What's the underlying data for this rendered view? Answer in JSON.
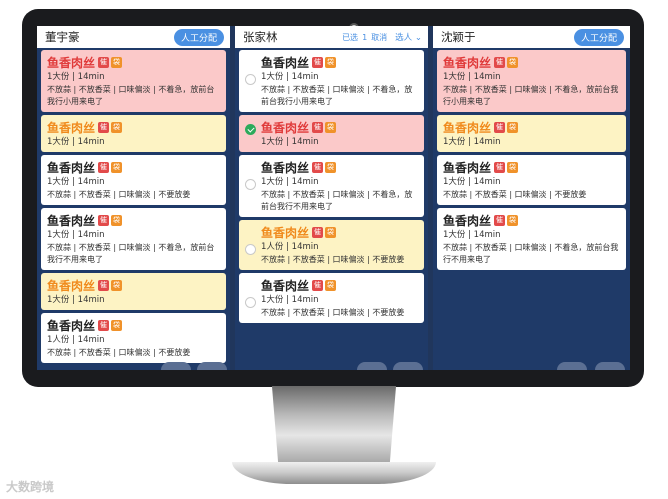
{
  "watermark": "大数跨境",
  "columns": [
    {
      "name": "董宇豪",
      "assign_label": "人工分配",
      "cards": [
        {
          "dish": "鱼香肉丝",
          "urge": "催",
          "bag": "袋",
          "meta": "1大份 | 14min",
          "notes": "不放蒜 | 不放香菜 | 口味偏淡 | 不着急，放前台我行小用来电了"
        },
        {
          "dish": "鱼香肉丝",
          "urge": "催",
          "bag": "袋",
          "meta": "1大份 | 14min",
          "notes": ""
        },
        {
          "dish": "鱼香肉丝",
          "urge": "催",
          "bag": "袋",
          "meta": "1大份 | 14min",
          "notes": "不放蒜 | 不放香菜 | 口味偏淡 | 不要放姜"
        },
        {
          "dish": "鱼香肉丝",
          "urge": "催",
          "bag": "袋",
          "meta": "1大份 | 14min",
          "notes": "不放蒜 | 不放香菜 | 口味偏淡 | 不着急，放前台我行不用来电了"
        },
        {
          "dish": "鱼香肉丝",
          "urge": "催",
          "bag": "袋",
          "meta": "1大份 | 14min",
          "notes": ""
        },
        {
          "dish": "鱼香肉丝",
          "urge": "催",
          "bag": "袋",
          "meta": "1人份 | 14min",
          "notes": "不放蒜 | 不放香菜 | 口味偏淡 | 不要放姜"
        }
      ]
    },
    {
      "name": "张家林",
      "selected_prefix": "已选",
      "selected_count": "1",
      "cancel_label": "取消",
      "pick_label": "选人",
      "cards": [
        {
          "dish": "鱼香肉丝",
          "urge": "催",
          "bag": "袋",
          "meta": "1大份 | 14min",
          "notes": "不放蒜 | 不放香菜 | 口味偏淡 | 不着急，放前台我行小用来电了"
        },
        {
          "dish": "鱼香肉丝",
          "urge": "催",
          "bag": "袋",
          "meta": "1大份 | 14min",
          "notes": ""
        },
        {
          "dish": "鱼香肉丝",
          "urge": "催",
          "bag": "袋",
          "meta": "1大份 | 14min",
          "notes": "不放蒜 | 不放香菜 | 口味偏淡 | 不着急，放前台我行不用来电了"
        },
        {
          "dish": "鱼香肉丝",
          "urge": "催",
          "bag": "袋",
          "meta": "1人份 | 14min",
          "notes": "不放蒜 | 不放香菜 | 口味偏淡 | 不要放姜"
        },
        {
          "dish": "鱼香肉丝",
          "urge": "催",
          "bag": "袋",
          "meta": "1大份 | 14min",
          "notes": "不放蒜 | 不放香菜 | 口味偏淡 | 不要放姜"
        }
      ]
    },
    {
      "name": "沈颖于",
      "assign_label": "人工分配",
      "cards": [
        {
          "dish": "鱼香肉丝",
          "urge": "催",
          "bag": "袋",
          "meta": "1大份 | 14min",
          "notes": "不放蒜 | 不放香菜 | 口味偏淡 | 不着急，放前台我行小用来电了"
        },
        {
          "dish": "鱼香肉丝",
          "urge": "催",
          "bag": "袋",
          "meta": "1大份 | 14min",
          "notes": ""
        },
        {
          "dish": "鱼香肉丝",
          "urge": "催",
          "bag": "袋",
          "meta": "1大份 | 14min",
          "notes": "不放蒜 | 不放香菜 | 口味偏淡 | 不要放姜"
        },
        {
          "dish": "鱼香肉丝",
          "urge": "催",
          "bag": "袋",
          "meta": "1大份 | 14min",
          "notes": "不放蒜 | 不放香菜 | 口味偏淡 | 不着急，放前台我行不用来电了"
        }
      ]
    }
  ],
  "colors": {
    "urgent_card": "#fbc9c9",
    "warning_card": "#fdf3c4",
    "accent": "#4a90e2",
    "check": "#2daa5c",
    "screen_bg": "#20365c"
  },
  "icons": [
    "camera-icon",
    "check-icon",
    "chevron-down-icon",
    "urge-badge-icon",
    "bag-badge-icon"
  ]
}
